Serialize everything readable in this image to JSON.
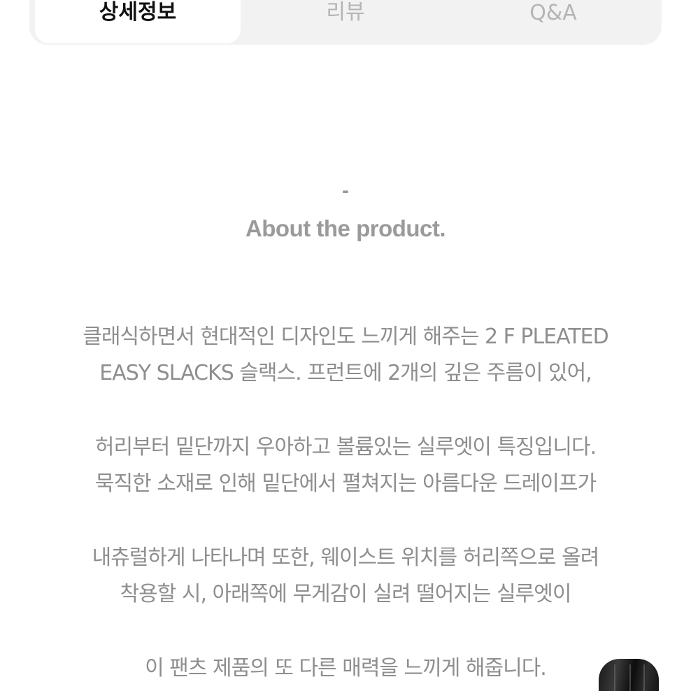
{
  "tabs": [
    {
      "label": "상세정보",
      "active": true
    },
    {
      "label": "리뷰",
      "active": false
    },
    {
      "label": "Q&A",
      "active": false
    }
  ],
  "section": {
    "dash": "-",
    "heading": "About the product."
  },
  "description": {
    "lines": [
      "클래식하면서 현대적인 디자인도 느끼게 해주는 2 F PLEATED",
      "EASY SLACKS 슬랙스. 프런트에 2개의 깊은 주름이 있어,",
      "",
      "허리부터 밑단까지 우아하고 볼륨있는 실루엣이 특징입니다.",
      "묵직한 소재로 인해 밑단에서 펼쳐지는 아름다운 드레이프가",
      "",
      "내츄럴하게 나타나며 또한, 웨이스트 위치를 허리쪽으로 올려",
      "착용할 시, 아래쪽에 무게감이 실려 떨어지는 실루엣이",
      "",
      "이 팬츠 제품의 또 다른 매력을 느끼게 해줍니다."
    ]
  },
  "colors": {
    "tab_bar_bg": "#f2f2f2",
    "active_tab_text": "#111111",
    "inactive_tab_text": "#b4b4b4",
    "body_text": "#8e8e8e"
  }
}
